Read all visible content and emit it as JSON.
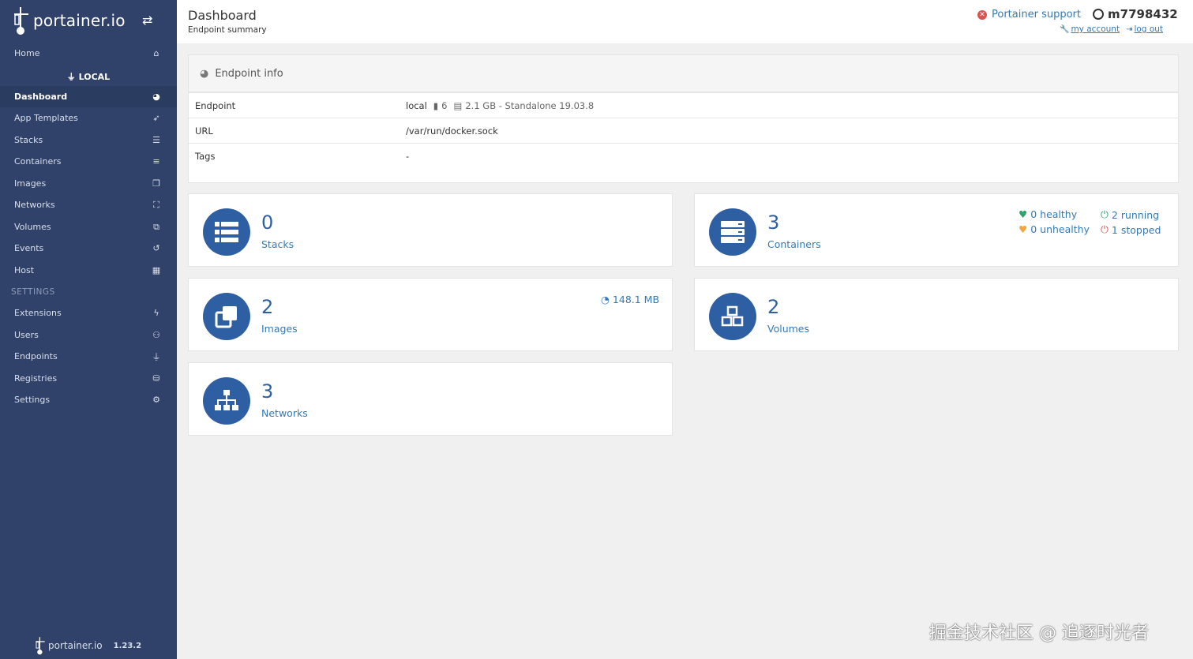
{
  "brand": {
    "name": "portainer.io"
  },
  "sidebar": {
    "home": "Home",
    "endpoint": "LOCAL",
    "items": [
      "Dashboard",
      "App Templates",
      "Stacks",
      "Containers",
      "Images",
      "Networks",
      "Volumes",
      "Events",
      "Host"
    ],
    "settings_header": "SETTINGS",
    "settings_items": [
      "Extensions",
      "Users",
      "Endpoints",
      "Registries",
      "Settings"
    ],
    "footer_brand": "portainer.io",
    "version": "1.23.2"
  },
  "header": {
    "title": "Dashboard",
    "subtitle": "Endpoint summary",
    "support": "Portainer support",
    "username": "m7798432",
    "my_account": "my account",
    "logout": "log out"
  },
  "endpoint_info": {
    "title": "Endpoint info",
    "rows": {
      "endpoint_key": "Endpoint",
      "endpoint_name": "local",
      "cpu": "6",
      "memory": "2.1 GB - Standalone 19.03.8",
      "url_key": "URL",
      "url_value": "/var/run/docker.sock",
      "tags_key": "Tags",
      "tags_value": "-"
    }
  },
  "cards": {
    "stacks": {
      "count": "0",
      "label": "Stacks"
    },
    "containers": {
      "count": "3",
      "label": "Containers",
      "healthy": "0 healthy",
      "unhealthy": "0 unhealthy",
      "running": "2 running",
      "stopped": "1 stopped"
    },
    "images": {
      "count": "2",
      "label": "Images",
      "size": "148.1 MB"
    },
    "volumes": {
      "count": "2",
      "label": "Volumes"
    },
    "networks": {
      "count": "3",
      "label": "Networks"
    }
  },
  "watermark": "掘金技术社区 @ 追逐时光者"
}
